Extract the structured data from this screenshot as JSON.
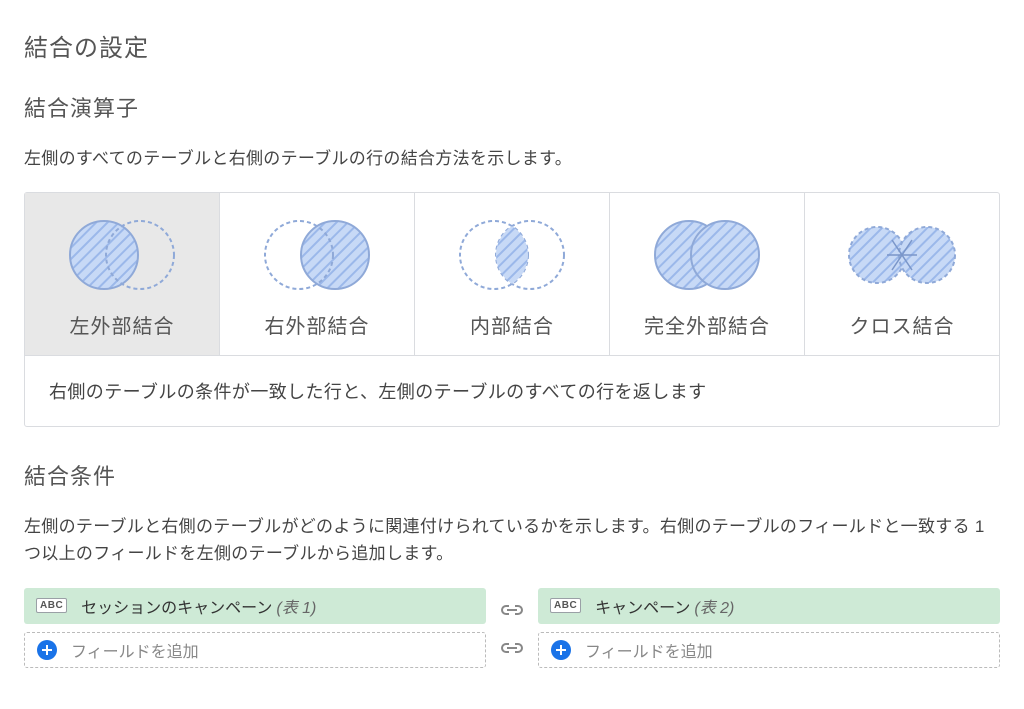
{
  "page_title": "結合の設定",
  "operator_section": {
    "title": "結合演算子",
    "description": "左側のすべてのテーブルと右側のテーブルの行の結合方法を示します。",
    "options": [
      {
        "label": "左外部結合"
      },
      {
        "label": "右外部結合"
      },
      {
        "label": "内部結合"
      },
      {
        "label": "完全外部結合"
      },
      {
        "label": "クロス結合"
      }
    ],
    "selected_index": 0,
    "selected_description": "右側のテーブルの条件が一致した行と、左側のテーブルのすべての行を返します"
  },
  "condition_section": {
    "title": "結合条件",
    "description": "左側のテーブルと右側のテーブルがどのように関連付けられているかを示します。右側のテーブルのフィールドと一致する 1 つ以上のフィールドを左側のテーブルから追加します。",
    "left": {
      "type_badge": "ABC",
      "field_name": "セッションのキャンペーン",
      "suffix": "(表 1)",
      "add_placeholder": "フィールドを追加"
    },
    "right": {
      "type_badge": "ABC",
      "field_name": "キャンペーン",
      "suffix": "(表 2)",
      "add_placeholder": "フィールドを追加"
    }
  }
}
